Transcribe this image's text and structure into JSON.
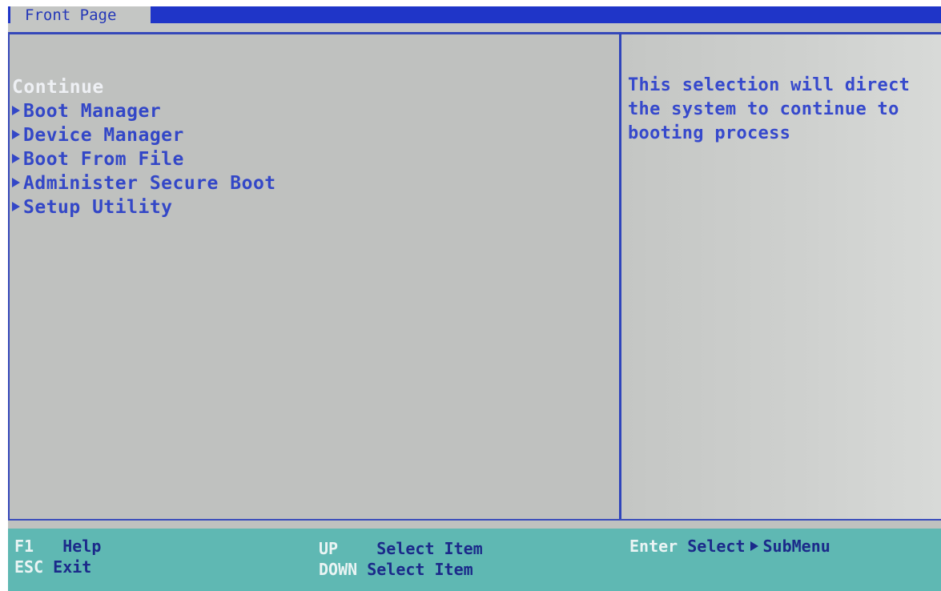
{
  "top_tab": {
    "label": "Front Page"
  },
  "menu": {
    "items": [
      {
        "label": "Continue",
        "selected": true,
        "has_submenu": false
      },
      {
        "label": "Boot Manager",
        "selected": false,
        "has_submenu": true
      },
      {
        "label": "Device Manager",
        "selected": false,
        "has_submenu": true
      },
      {
        "label": "Boot From File",
        "selected": false,
        "has_submenu": true
      },
      {
        "label": "Administer Secure Boot",
        "selected": false,
        "has_submenu": true
      },
      {
        "label": "Setup Utility",
        "selected": false,
        "has_submenu": true
      }
    ]
  },
  "help_panel": {
    "text": "This selection will direct\nthe system to continue to\nbooting process"
  },
  "footer": {
    "f1_key": "F1",
    "f1_desc": "Help",
    "esc_key": "ESC",
    "esc_desc": "Exit",
    "up_key": "UP",
    "up_desc": "Select Item",
    "down_key": "DOWN",
    "down_desc": "Select Item",
    "enter_key": "Enter",
    "enter_desc_1": "Select",
    "enter_desc_2": "SubMenu"
  },
  "icons": {
    "submenu": "triangle-right-icon"
  },
  "colors": {
    "title_bar": "#1f35c8",
    "background": "#bfc1bf",
    "menu_text": "#3347c7",
    "selected_text": "#eef0f4",
    "footer": "#5fb8b3"
  }
}
